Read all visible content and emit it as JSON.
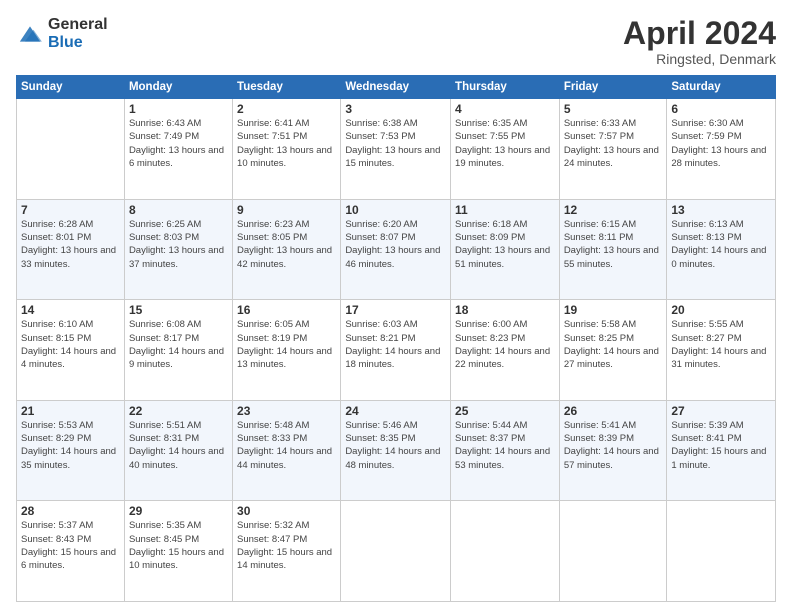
{
  "header": {
    "logo_general": "General",
    "logo_blue": "Blue",
    "title": "April 2024",
    "location": "Ringsted, Denmark"
  },
  "days_of_week": [
    "Sunday",
    "Monday",
    "Tuesday",
    "Wednesday",
    "Thursday",
    "Friday",
    "Saturday"
  ],
  "weeks": [
    [
      {
        "day": "",
        "sunrise": "",
        "sunset": "",
        "daylight": ""
      },
      {
        "day": "1",
        "sunrise": "6:43 AM",
        "sunset": "7:49 PM",
        "daylight": "13 hours and 6 minutes."
      },
      {
        "day": "2",
        "sunrise": "6:41 AM",
        "sunset": "7:51 PM",
        "daylight": "13 hours and 10 minutes."
      },
      {
        "day": "3",
        "sunrise": "6:38 AM",
        "sunset": "7:53 PM",
        "daylight": "13 hours and 15 minutes."
      },
      {
        "day": "4",
        "sunrise": "6:35 AM",
        "sunset": "7:55 PM",
        "daylight": "13 hours and 19 minutes."
      },
      {
        "day": "5",
        "sunrise": "6:33 AM",
        "sunset": "7:57 PM",
        "daylight": "13 hours and 24 minutes."
      },
      {
        "day": "6",
        "sunrise": "6:30 AM",
        "sunset": "7:59 PM",
        "daylight": "13 hours and 28 minutes."
      }
    ],
    [
      {
        "day": "7",
        "sunrise": "6:28 AM",
        "sunset": "8:01 PM",
        "daylight": "13 hours and 33 minutes."
      },
      {
        "day": "8",
        "sunrise": "6:25 AM",
        "sunset": "8:03 PM",
        "daylight": "13 hours and 37 minutes."
      },
      {
        "day": "9",
        "sunrise": "6:23 AM",
        "sunset": "8:05 PM",
        "daylight": "13 hours and 42 minutes."
      },
      {
        "day": "10",
        "sunrise": "6:20 AM",
        "sunset": "8:07 PM",
        "daylight": "13 hours and 46 minutes."
      },
      {
        "day": "11",
        "sunrise": "6:18 AM",
        "sunset": "8:09 PM",
        "daylight": "13 hours and 51 minutes."
      },
      {
        "day": "12",
        "sunrise": "6:15 AM",
        "sunset": "8:11 PM",
        "daylight": "13 hours and 55 minutes."
      },
      {
        "day": "13",
        "sunrise": "6:13 AM",
        "sunset": "8:13 PM",
        "daylight": "14 hours and 0 minutes."
      }
    ],
    [
      {
        "day": "14",
        "sunrise": "6:10 AM",
        "sunset": "8:15 PM",
        "daylight": "14 hours and 4 minutes."
      },
      {
        "day": "15",
        "sunrise": "6:08 AM",
        "sunset": "8:17 PM",
        "daylight": "14 hours and 9 minutes."
      },
      {
        "day": "16",
        "sunrise": "6:05 AM",
        "sunset": "8:19 PM",
        "daylight": "14 hours and 13 minutes."
      },
      {
        "day": "17",
        "sunrise": "6:03 AM",
        "sunset": "8:21 PM",
        "daylight": "14 hours and 18 minutes."
      },
      {
        "day": "18",
        "sunrise": "6:00 AM",
        "sunset": "8:23 PM",
        "daylight": "14 hours and 22 minutes."
      },
      {
        "day": "19",
        "sunrise": "5:58 AM",
        "sunset": "8:25 PM",
        "daylight": "14 hours and 27 minutes."
      },
      {
        "day": "20",
        "sunrise": "5:55 AM",
        "sunset": "8:27 PM",
        "daylight": "14 hours and 31 minutes."
      }
    ],
    [
      {
        "day": "21",
        "sunrise": "5:53 AM",
        "sunset": "8:29 PM",
        "daylight": "14 hours and 35 minutes."
      },
      {
        "day": "22",
        "sunrise": "5:51 AM",
        "sunset": "8:31 PM",
        "daylight": "14 hours and 40 minutes."
      },
      {
        "day": "23",
        "sunrise": "5:48 AM",
        "sunset": "8:33 PM",
        "daylight": "14 hours and 44 minutes."
      },
      {
        "day": "24",
        "sunrise": "5:46 AM",
        "sunset": "8:35 PM",
        "daylight": "14 hours and 48 minutes."
      },
      {
        "day": "25",
        "sunrise": "5:44 AM",
        "sunset": "8:37 PM",
        "daylight": "14 hours and 53 minutes."
      },
      {
        "day": "26",
        "sunrise": "5:41 AM",
        "sunset": "8:39 PM",
        "daylight": "14 hours and 57 minutes."
      },
      {
        "day": "27",
        "sunrise": "5:39 AM",
        "sunset": "8:41 PM",
        "daylight": "15 hours and 1 minute."
      }
    ],
    [
      {
        "day": "28",
        "sunrise": "5:37 AM",
        "sunset": "8:43 PM",
        "daylight": "15 hours and 6 minutes."
      },
      {
        "day": "29",
        "sunrise": "5:35 AM",
        "sunset": "8:45 PM",
        "daylight": "15 hours and 10 minutes."
      },
      {
        "day": "30",
        "sunrise": "5:32 AM",
        "sunset": "8:47 PM",
        "daylight": "15 hours and 14 minutes."
      },
      {
        "day": "",
        "sunrise": "",
        "sunset": "",
        "daylight": ""
      },
      {
        "day": "",
        "sunrise": "",
        "sunset": "",
        "daylight": ""
      },
      {
        "day": "",
        "sunrise": "",
        "sunset": "",
        "daylight": ""
      },
      {
        "day": "",
        "sunrise": "",
        "sunset": "",
        "daylight": ""
      }
    ]
  ],
  "labels": {
    "sunrise_prefix": "Sunrise: ",
    "sunset_prefix": "Sunset: ",
    "daylight_prefix": "Daylight: "
  }
}
